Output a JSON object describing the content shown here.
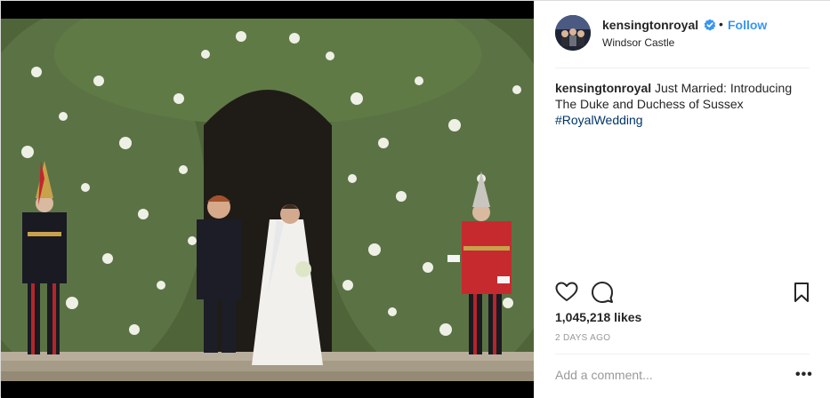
{
  "post": {
    "username": "kensingtonroyal",
    "verified_icon": "verified-badge-icon",
    "separator": "•",
    "follow_label": "Follow",
    "location": "Windsor Castle",
    "caption": {
      "username": "kensingtonroyal",
      "text": "Just Married: Introducing The Duke and Duchess of Sussex",
      "hashtag": "#RoyalWedding"
    },
    "likes": "1,045,218 likes",
    "time": "2 DAYS AGO",
    "comment_placeholder": "Add a comment...",
    "more_label": "•••",
    "icons": [
      "heart-icon",
      "comment-icon",
      "bookmark-icon"
    ]
  },
  "colors": {
    "accent": "#3897f0",
    "hashtag": "#003569",
    "muted": "#999999",
    "border": "#dbdbdb"
  }
}
